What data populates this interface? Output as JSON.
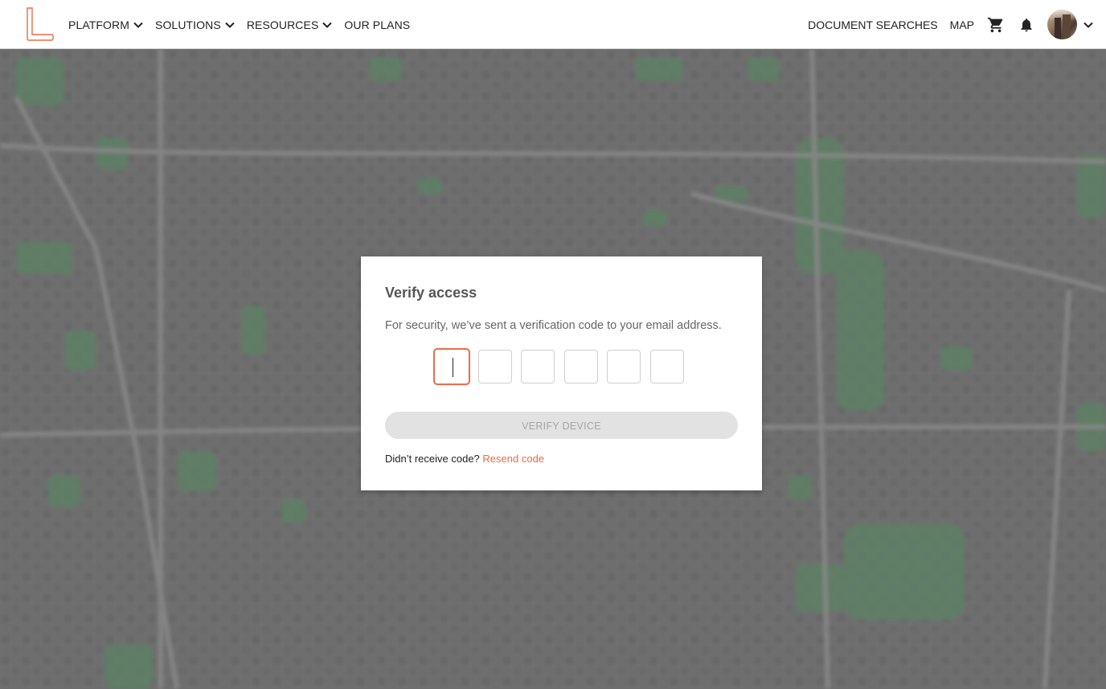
{
  "nav": {
    "left_items": [
      {
        "label": "PLATFORM",
        "has_dropdown": true
      },
      {
        "label": "SOLUTIONS",
        "has_dropdown": true
      },
      {
        "label": "RESOURCES",
        "has_dropdown": true
      },
      {
        "label": "OUR PLANS",
        "has_dropdown": false
      }
    ],
    "right_links": [
      {
        "label": "DOCUMENT SEARCHES"
      },
      {
        "label": "MAP"
      }
    ],
    "icons": [
      "cart-icon",
      "bell-icon",
      "avatar",
      "chevron-down-icon"
    ]
  },
  "dialog": {
    "title": "Verify access",
    "description": "For security, we’ve sent a verification code to your email address.",
    "code_length": 6,
    "code_values": [
      "",
      "",
      "",
      "",
      "",
      ""
    ],
    "verify_button_label": "VERIFY DEVICE",
    "resend_prompt": "Didn’t receive code?",
    "resend_link": "Resend code"
  },
  "colors": {
    "accent": "#ee6a47",
    "button_disabled_bg": "#e2e2e2",
    "button_disabled_text": "#a6a6a6",
    "map_overlay": "#6e6e6e",
    "park_green": "#5f7f66"
  }
}
